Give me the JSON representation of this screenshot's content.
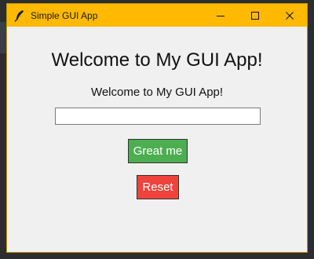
{
  "window": {
    "title": "Simple GUI App"
  },
  "titlebar_controls": {
    "minimize_icon": "minimize-icon",
    "maximize_icon": "maximize-icon",
    "close_icon": "close-icon"
  },
  "main": {
    "heading": "Welcome to My GUI App!",
    "label": "Welcome to My GUI App!",
    "entry_value": "",
    "greet_button": "Great me",
    "reset_button": "Reset"
  },
  "colors": {
    "titlebar": "#ffb900",
    "greet_button": "#4cae50",
    "reset_button": "#f0433c",
    "window_bg": "#f0f0f0"
  }
}
